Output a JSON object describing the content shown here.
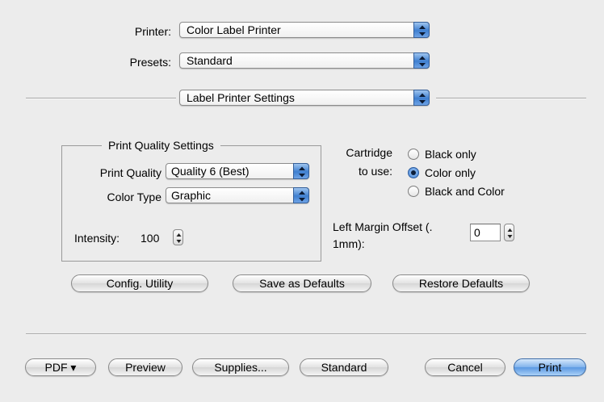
{
  "printer": {
    "label": "Printer:",
    "value": "Color Label Printer"
  },
  "presets": {
    "label": "Presets:",
    "value": "Standard"
  },
  "panel_selector": {
    "value": "Label Printer Settings"
  },
  "quality_group": {
    "title": "Print Quality Settings",
    "print_quality": {
      "label": "Print Quality",
      "value": "Quality 6 (Best)"
    },
    "color_type": {
      "label": "Color Type",
      "value": "Graphic"
    },
    "intensity": {
      "label": "Intensity:",
      "value": "100"
    }
  },
  "cartridge": {
    "label_line1": "Cartridge",
    "label_line2": "to use:",
    "options": [
      {
        "label": "Black only",
        "selected": false
      },
      {
        "label": "Color only",
        "selected": true
      },
      {
        "label": "Black and Color",
        "selected": false
      }
    ]
  },
  "left_margin": {
    "label_line1": "Left Margin Offset (.",
    "label_line2": "1mm):",
    "value": "0"
  },
  "actions": {
    "config": "Config. Utility",
    "save_defaults": "Save as Defaults",
    "restore_defaults": "Restore Defaults"
  },
  "footer": {
    "pdf": "PDF ▾",
    "preview": "Preview",
    "supplies": "Supplies...",
    "standard": "Standard",
    "cancel": "Cancel",
    "print": "Print"
  },
  "colors": {
    "window_bg": "#ececec",
    "accent": "#3f7fd0"
  },
  "icons": {
    "popup_arrows": "updown-arrows-icon",
    "stepper": "stepper-arrows-icon"
  }
}
